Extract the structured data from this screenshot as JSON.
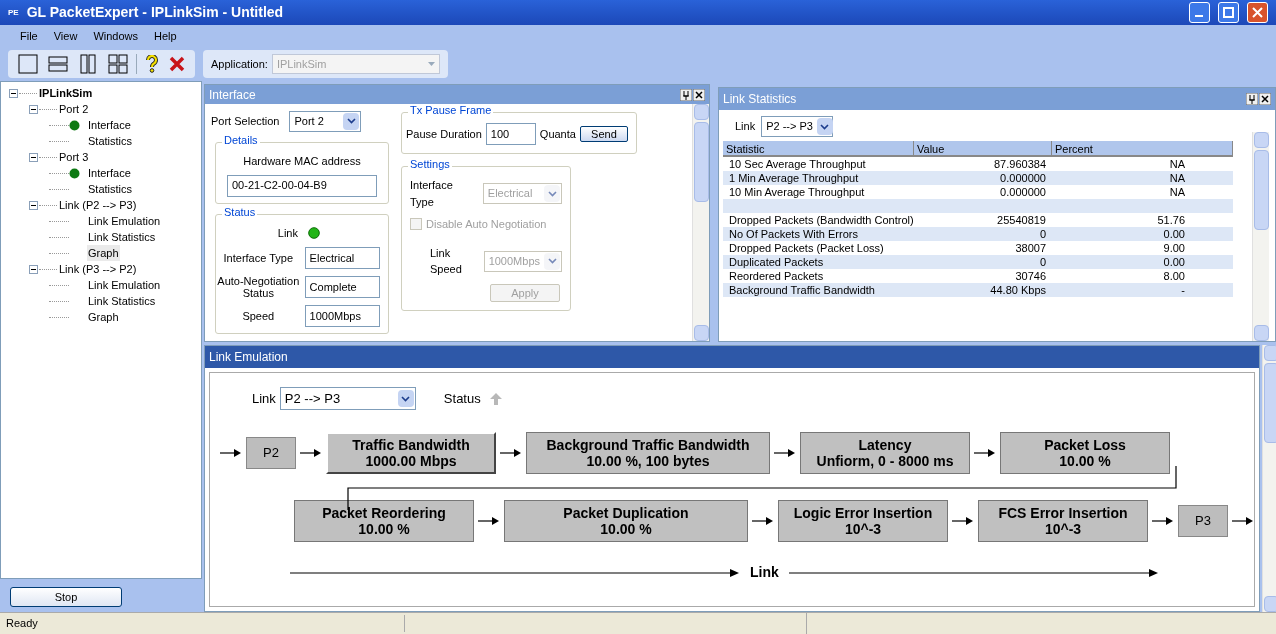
{
  "window": {
    "title": "GL PacketExpert - IPLinkSim - Untitled",
    "app_badge": "PE"
  },
  "menu": [
    "File",
    "View",
    "Windows",
    "Help"
  ],
  "toolbar": {
    "application_label": "Application:",
    "application_value": "IPLinkSim"
  },
  "tree": {
    "label": "IPLinkSim",
    "expanded": true,
    "children": [
      {
        "label": "Port 2",
        "expanded": true,
        "children": [
          {
            "label": "Interface",
            "link_up": true,
            "selected": false
          },
          {
            "label": "Statistics",
            "link_up": false,
            "selected": false
          }
        ]
      },
      {
        "label": "Port 3",
        "expanded": true,
        "children": [
          {
            "label": "Interface",
            "link_up": true,
            "selected": false
          },
          {
            "label": "Statistics",
            "link_up": false,
            "selected": false
          }
        ]
      },
      {
        "label": "Link (P2 --> P3)",
        "expanded": true,
        "children": [
          {
            "label": "Link Emulation",
            "link_up": false,
            "selected": false
          },
          {
            "label": "Link Statistics",
            "link_up": false,
            "selected": false
          },
          {
            "label": "Graph",
            "link_up": false,
            "selected": true
          }
        ]
      },
      {
        "label": "Link (P3 --> P2)",
        "expanded": true,
        "children": [
          {
            "label": "Link Emulation",
            "link_up": false,
            "selected": false
          },
          {
            "label": "Link Statistics",
            "link_up": false,
            "selected": false
          },
          {
            "label": "Graph",
            "link_up": false,
            "selected": false
          }
        ]
      }
    ]
  },
  "stop_button": "Stop",
  "interface_panel": {
    "title": "Interface",
    "port_selection": {
      "label": "Port Selection",
      "value": "Port 2"
    },
    "details": {
      "title": "Details",
      "label": "Hardware MAC address",
      "value": "00-21-C2-00-04-B9"
    },
    "status": {
      "title": "Status",
      "link_label": "Link",
      "link_up": true,
      "fields": [
        {
          "label": "Interface Type",
          "value": "Electrical"
        },
        {
          "label": "Auto-Negotiation Status",
          "value": "Complete"
        },
        {
          "label": "Speed",
          "value": "1000Mbps"
        }
      ]
    },
    "tx_pause_frame": {
      "title": "Tx Pause Frame",
      "label": "Pause Duration",
      "value": "100",
      "unit": "Quanta",
      "button": "Send"
    },
    "settings": {
      "title": "Settings",
      "interface_type": {
        "label": "Interface Type",
        "value": "Electrical",
        "disabled": true
      },
      "auto_negotiation": {
        "label": "Disable Auto Negotiation",
        "checked": false,
        "disabled": true
      },
      "link_speed": {
        "label": "Link Speed",
        "value": "1000Mbps",
        "disabled": true
      },
      "apply": {
        "label": "Apply",
        "disabled": true
      }
    }
  },
  "link_statistics": {
    "title": "Link Statistics",
    "link_label": "Link",
    "link_value": "P2 --> P3",
    "columns": [
      "Statistic",
      "Value",
      "Percent"
    ],
    "rows": [
      {
        "kind": "data",
        "cells": [
          "10 Sec Average Throughput",
          "87.960384",
          "NA"
        ]
      },
      {
        "kind": "data",
        "cells": [
          "1 Min Average Throughput",
          "0.000000",
          "NA"
        ]
      },
      {
        "kind": "data",
        "cells": [
          "10 Min Average Throughput",
          "0.000000",
          "NA"
        ]
      },
      {
        "kind": "spacer"
      },
      {
        "kind": "data",
        "cells": [
          "Dropped Packets (Bandwidth Control)",
          "25540819",
          "51.76"
        ]
      },
      {
        "kind": "data",
        "cells": [
          "No Of Packets With Errors",
          "0",
          "0.00"
        ]
      },
      {
        "kind": "data",
        "cells": [
          "Dropped Packets (Packet Loss)",
          "38007",
          "9.00"
        ]
      },
      {
        "kind": "data",
        "cells": [
          "Duplicated Packets",
          "0",
          "0.00"
        ]
      },
      {
        "kind": "data",
        "cells": [
          "Reordered Packets",
          "30746",
          "8.00"
        ]
      },
      {
        "kind": "data",
        "cells": [
          "Background Traffic Bandwidth",
          "44.80 Kbps",
          "-"
        ]
      }
    ]
  },
  "link_emulation": {
    "title": "Link Emulation",
    "link_label": "Link",
    "link_value": "P2 --> P3",
    "status_label": "Status",
    "stages": [
      {
        "kind": "port",
        "label": "P2"
      },
      {
        "kind": "block",
        "title": "Traffic Bandwidth",
        "value": "1000.00 Mbps",
        "selected": true
      },
      {
        "kind": "block",
        "title": "Background Traffic Bandwidth",
        "value": "10.00 %, 100 bytes",
        "selected": false
      },
      {
        "kind": "block",
        "title": "Latency",
        "value": "Unfiorm, 0 - 8000 ms",
        "selected": false
      },
      {
        "kind": "block",
        "title": "Packet Loss",
        "value": "10.00 %",
        "selected": false
      },
      {
        "kind": "block",
        "title": "Packet Reordering",
        "value": "10.00 %",
        "selected": false
      },
      {
        "kind": "block",
        "title": "Packet Duplication",
        "value": "10.00 %",
        "selected": false
      },
      {
        "kind": "block",
        "title": "Logic Error Insertion",
        "value": "10^-3",
        "selected": false
      },
      {
        "kind": "block",
        "title": "FCS Error Insertion",
        "value": "10^-3",
        "selected": false
      },
      {
        "kind": "port",
        "label": "P3"
      }
    ],
    "axis_label": "Link"
  },
  "status_bar": "Ready"
}
